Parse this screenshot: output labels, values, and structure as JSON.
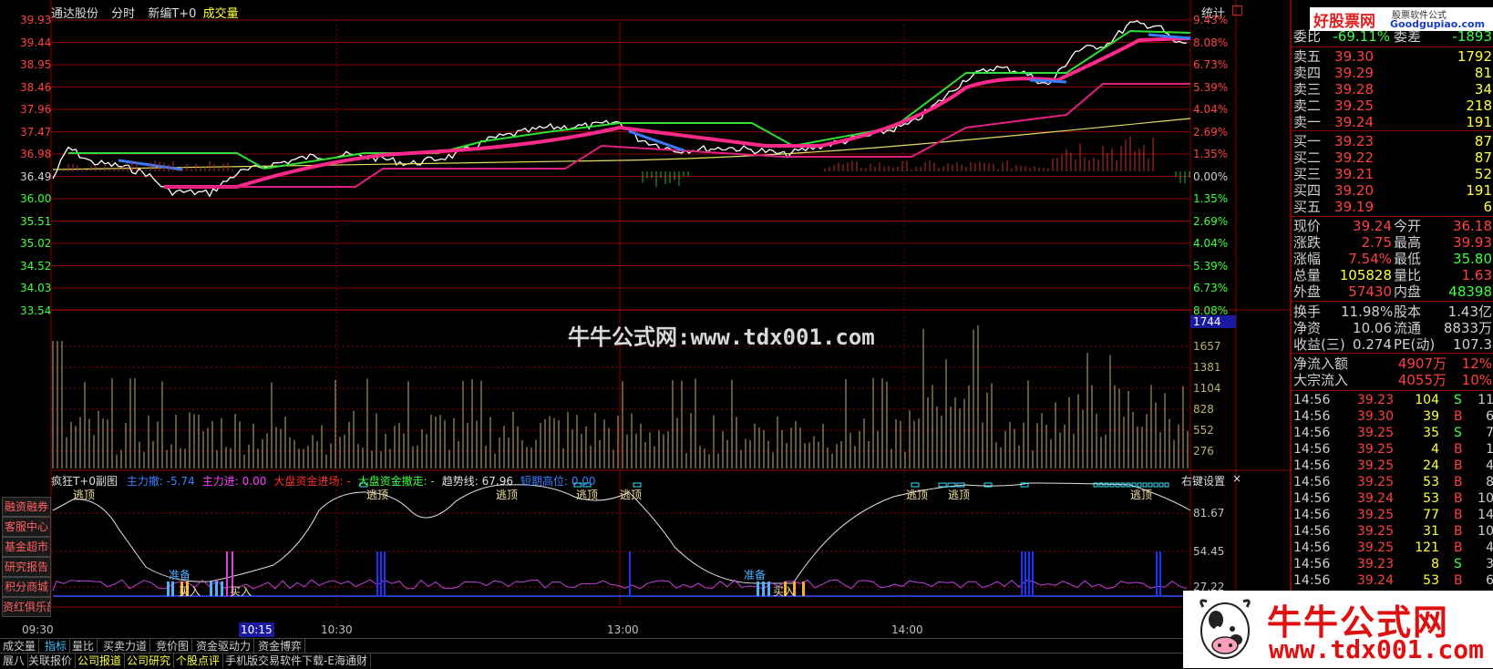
{
  "header": {
    "stock_name": "通达股份",
    "mode": "分时",
    "formula": "新编T+0",
    "indicator": "成交量",
    "stat_button": "统计"
  },
  "price_axis": {
    "left_labels": [
      "39.93",
      "39.44",
      "38.95",
      "38.46",
      "37.96",
      "37.47",
      "36.98",
      "36.49",
      "36.00",
      "35.51",
      "35.02",
      "34.52",
      "34.03",
      "33.54"
    ],
    "right_labels": [
      "9.43%",
      "8.08%",
      "6.73%",
      "5.39%",
      "4.04%",
      "2.69%",
      "1.35%",
      "0.00%",
      "1.35%",
      "2.69%",
      "4.04%",
      "5.39%",
      "6.73%",
      "8.08%"
    ]
  },
  "volume_axis": {
    "current": "1744",
    "labels": [
      "1657",
      "1381",
      "1104",
      "828",
      "552",
      "276"
    ]
  },
  "sub_chart": {
    "title": "疯狂T+0副图",
    "items": [
      {
        "label": "主力撤: -5.74",
        "color": "#4080ff"
      },
      {
        "label": "主力进: 0.00",
        "color": "#ff40ff"
      },
      {
        "label": "大盘资金进场: -",
        "color": "#ff3030"
      },
      {
        "label": "大盘资金撤走: -",
        "color": "#40ff40"
      },
      {
        "label": "趋势线: 67.96",
        "color": "#e0e0e0"
      },
      {
        "label": "短期高位: 0.00",
        "color": "#4080ff"
      }
    ],
    "settings": "右键设置",
    "close": "×",
    "axis_labels": [
      "81.67",
      "54.45",
      "27.22"
    ],
    "signal_top": "逃顶",
    "signal_ready": "准备",
    "signal_buy": "买入"
  },
  "time_axis": {
    "labels": [
      "09:30",
      "10:15",
      "10:30",
      "13:00",
      "14:00"
    ]
  },
  "watermark": "牛牛公式网:www.tdx001.com",
  "left_menu": [
    "融资融券",
    "客服中心",
    "基金超市",
    "研究报告",
    "积分商城",
    "资红俱乐部"
  ],
  "bottom_tabs_1": [
    "成交量",
    "指标",
    "量比",
    "买卖力道",
    "竞价图",
    "资金驱动力",
    "资金博弈"
  ],
  "bottom_tabs_2": [
    "展八",
    "关联报价",
    "公司报道",
    "公司研究",
    "个股点评",
    "手机版交易软件下载-E海通财"
  ],
  "logos": {
    "top_site": "好股票网",
    "top_domain": "Goodgupiao.com",
    "top_sub": "股票软件公式",
    "bottom_name": "牛牛公式网",
    "bottom_url": "www.tdx001.com"
  },
  "quote": {
    "weibi_label": "委比",
    "weibi_value": "-69.11%",
    "weicha_label": "委差",
    "weicha_value": "-1893",
    "sell": [
      {
        "label": "卖五",
        "price": "39.30",
        "vol": "1792"
      },
      {
        "label": "卖四",
        "price": "39.29",
        "vol": "81"
      },
      {
        "label": "卖三",
        "price": "39.28",
        "vol": "34"
      },
      {
        "label": "卖二",
        "price": "39.25",
        "vol": "218"
      },
      {
        "label": "卖一",
        "price": "39.24",
        "vol": "191"
      }
    ],
    "buy": [
      {
        "label": "买一",
        "price": "39.23",
        "vol": "87"
      },
      {
        "label": "买二",
        "price": "39.22",
        "vol": "87"
      },
      {
        "label": "买三",
        "price": "39.21",
        "vol": "52"
      },
      {
        "label": "买四",
        "price": "39.20",
        "vol": "191"
      },
      {
        "label": "买五",
        "price": "39.19",
        "vol": "6"
      }
    ],
    "stats": [
      {
        "l1": "现价",
        "v1": "39.24",
        "l2": "今开",
        "v2": "36.18",
        "c1": "#ff4040",
        "c2": "#ff4040"
      },
      {
        "l1": "涨跌",
        "v1": "2.75",
        "l2": "最高",
        "v2": "39.93",
        "c1": "#ff4040",
        "c2": "#ff4040"
      },
      {
        "l1": "涨幅",
        "v1": "7.54%",
        "l2": "最低",
        "v2": "35.80",
        "c1": "#ff4040",
        "c2": "#40ff40"
      },
      {
        "l1": "总量",
        "v1": "105828",
        "l2": "量比",
        "v2": "1.63",
        "c1": "#ffff40",
        "c2": "#ff4040"
      },
      {
        "l1": "外盘",
        "v1": "57430",
        "l2": "内盘",
        "v2": "48398",
        "c1": "#ff4040",
        "c2": "#40ff40"
      }
    ],
    "stats2": [
      {
        "l1": "换手",
        "v1": "11.98%",
        "l2": "股本",
        "v2": "1.43亿"
      },
      {
        "l1": "净资",
        "v1": "10.06",
        "l2": "流通",
        "v2": "8833万"
      },
      {
        "l1": "收益(三)",
        "v1": "0.274",
        "l2": "PE(动)",
        "v2": "107.3"
      }
    ],
    "flow": [
      {
        "label": "净流入额",
        "value": "4907万",
        "pct": "12%"
      },
      {
        "label": "大宗流入",
        "value": "4055万",
        "pct": "10%"
      }
    ]
  },
  "ticks": [
    {
      "time": "14:56",
      "price": "39.23",
      "vol": "104",
      "dir": "S",
      "n": "11"
    },
    {
      "time": "14:56",
      "price": "39.30",
      "vol": "39",
      "dir": "B",
      "n": "6"
    },
    {
      "time": "14:56",
      "price": "39.25",
      "vol": "35",
      "dir": "S",
      "n": "7"
    },
    {
      "time": "14:56",
      "price": "39.25",
      "vol": "4",
      "dir": "B",
      "n": "1"
    },
    {
      "time": "14:56",
      "price": "39.25",
      "vol": "24",
      "dir": "B",
      "n": "4"
    },
    {
      "time": "14:56",
      "price": "39.25",
      "vol": "53",
      "dir": "B",
      "n": "8"
    },
    {
      "time": "14:56",
      "price": "39.24",
      "vol": "53",
      "dir": "B",
      "n": "10"
    },
    {
      "time": "14:56",
      "price": "39.25",
      "vol": "77",
      "dir": "B",
      "n": "14"
    },
    {
      "time": "14:56",
      "price": "39.25",
      "vol": "31",
      "dir": "B",
      "n": "10"
    },
    {
      "time": "14:56",
      "price": "39.25",
      "vol": "121",
      "dir": "B",
      "n": "4"
    },
    {
      "time": "14:56",
      "price": "39.23",
      "vol": "8",
      "dir": "S",
      "n": "3"
    },
    {
      "time": "14:56",
      "price": "39.24",
      "vol": "53",
      "dir": "B",
      "n": "6"
    },
    {
      "time": "14:56",
      "price": "39.24",
      "vol": "13",
      "dir": "B",
      "n": "5"
    }
  ],
  "colors": {
    "grid": "#8b0000",
    "up": "#ff4040",
    "down": "#40ff40",
    "price_line": "#ffffff",
    "avg_line": "#e0e060"
  }
}
